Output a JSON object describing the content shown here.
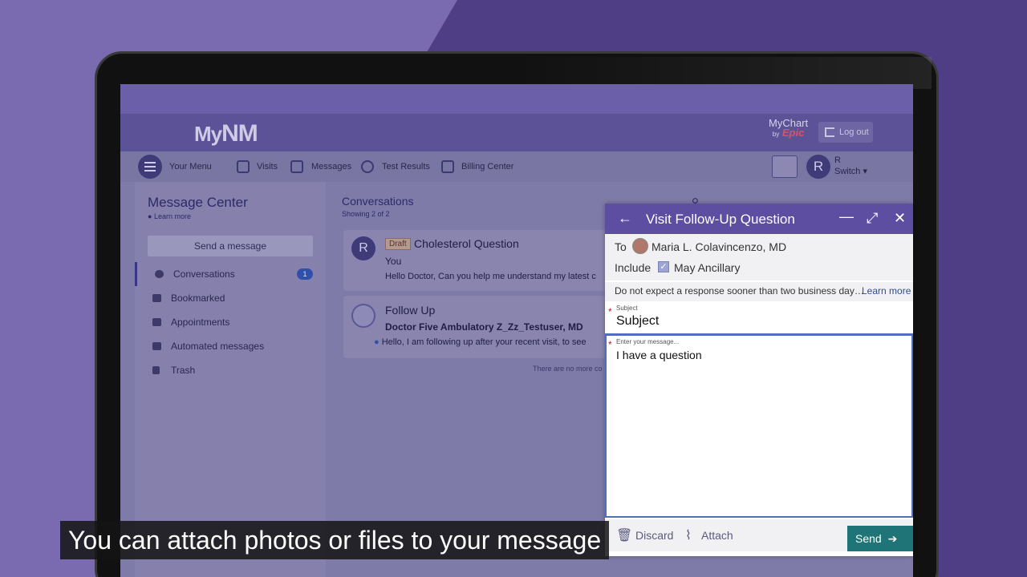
{
  "app": {
    "logo_text": "My",
    "logo_mark": "NM",
    "mychart": "MyChart",
    "by": "by",
    "epic": "Epic",
    "logout": "Log out"
  },
  "nav": {
    "your_menu": "Your Menu",
    "visits": "Visits",
    "messages": "Messages",
    "test_results": "Test Results",
    "billing": "Billing Center",
    "user_initial": "R",
    "switch": "Switch"
  },
  "message_center": {
    "title": "Message Center",
    "learn_more": "Learn more",
    "send_button": "Send a message",
    "folders": [
      {
        "label": "Conversations",
        "badge": "1"
      },
      {
        "label": "Bookmarked"
      },
      {
        "label": "Appointments"
      },
      {
        "label": "Automated messages"
      },
      {
        "label": "Trash"
      }
    ]
  },
  "conversations": {
    "title": "Conversations",
    "showing": "Showing 2 of 2",
    "items": [
      {
        "initial": "R",
        "tag": "Draft",
        "subject": "Cholesterol Question",
        "from": "You",
        "preview": "Hello Doctor, Can you help me understand my latest c"
      },
      {
        "subject": "Follow Up",
        "from": "Doctor Five Ambulatory Z_Zz_Testuser, MD",
        "preview": "Hello,   I am following up after your recent visit, to see"
      }
    ],
    "no_more": "There are no more co"
  },
  "compose": {
    "title": "Visit Follow-Up Question",
    "to_label": "To",
    "to_name": "Maria L. Colavincenzo, MD",
    "include_label": "Include",
    "include_name": "May Ancillary",
    "notice": "Do not expect a response sooner than two business day…",
    "notice_link": "Learn more",
    "subject_label": "Subject",
    "subject_value": "Subject",
    "message_label": "Enter your message...",
    "message_value": "I have a question",
    "discard": "Discard",
    "attach": "Attach",
    "send": "Send"
  },
  "caption": "You can attach photos or files to your message"
}
